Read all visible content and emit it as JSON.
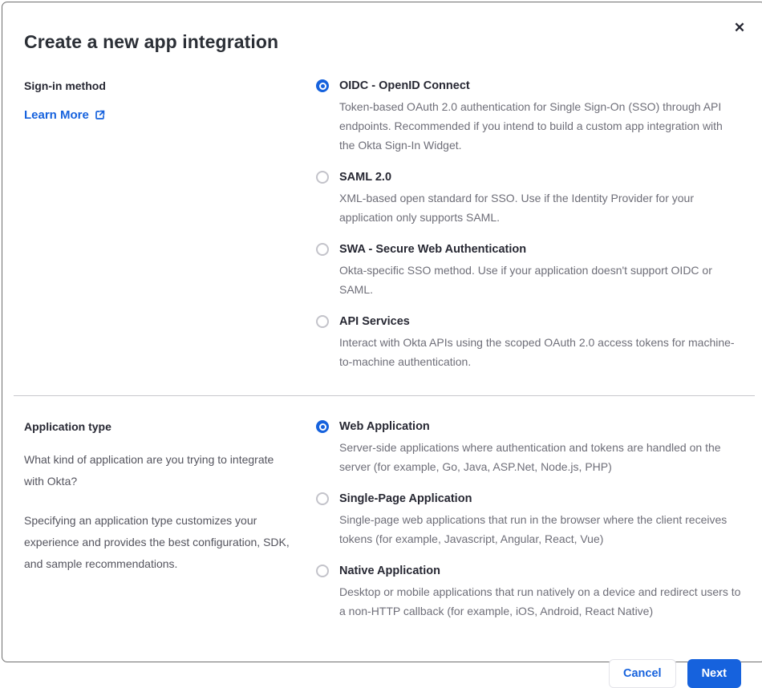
{
  "colors": {
    "accent_blue": "#1662dd",
    "text_dark": "#272833",
    "text_gray": "#6e6e78",
    "divider": "#c8c8cc",
    "radio_unselected_border": "#c3c3ca"
  },
  "icons": {
    "close": "✕",
    "external_link": "box-arrow-top-right"
  },
  "modal": {
    "title": "Create a new app integration"
  },
  "signin_section": {
    "label": "Sign-in method",
    "learn_more_label": "Learn More",
    "options": [
      {
        "label": "OIDC - OpenID Connect",
        "description": "Token-based OAuth 2.0 authentication for Single Sign-On (SSO) through API endpoints. Recommended if you intend to build a custom app integration with the Okta Sign-In Widget.",
        "selected": true
      },
      {
        "label": "SAML 2.0",
        "description": "XML-based open standard for SSO. Use if the Identity Provider for your application only supports SAML.",
        "selected": false
      },
      {
        "label": "SWA - Secure Web Authentication",
        "description": "Okta-specific SSO method. Use if your application doesn't support OIDC or SAML.",
        "selected": false
      },
      {
        "label": "API Services",
        "description": "Interact with Okta APIs using the scoped OAuth 2.0 access tokens for machine-to-machine authentication.",
        "selected": false
      }
    ]
  },
  "apptype_section": {
    "label": "Application type",
    "paragraph1": "What kind of application are you trying to integrate with Okta?",
    "paragraph2": "Specifying an application type customizes your experience and provides the best configuration, SDK, and sample recommendations.",
    "options": [
      {
        "label": "Web Application",
        "description": "Server-side applications where authentication and tokens are handled on the server (for example, Go, Java, ASP.Net, Node.js, PHP)",
        "selected": true
      },
      {
        "label": "Single-Page Application",
        "description": "Single-page web applications that run in the browser where the client receives tokens (for example, Javascript, Angular, React, Vue)",
        "selected": false
      },
      {
        "label": "Native Application",
        "description": "Desktop or mobile applications that run natively on a device and redirect users to a non-HTTP callback (for example, iOS, Android, React Native)",
        "selected": false
      }
    ]
  },
  "footer": {
    "cancel_label": "Cancel",
    "next_label": "Next"
  }
}
